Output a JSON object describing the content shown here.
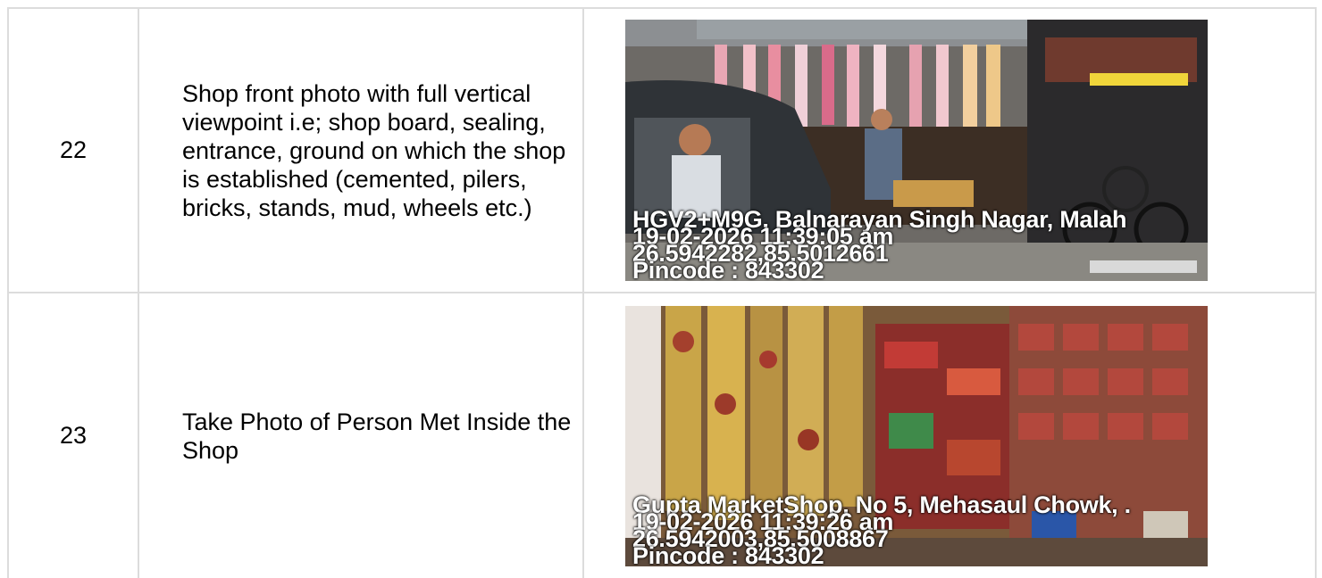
{
  "rows": [
    {
      "number": "22",
      "description": "Shop front photo with full vertical viewpoint i.e; shop board, sealing, entrance, ground on which the shop is established (cemented, pilers, bricks, stands, mud, wheels etc.)",
      "photo_stamp": {
        "address": "HGV2+M9G, Balnarayan Singh Nagar, Malah",
        "datetime": "19-02-2026 11:39:05 am",
        "coordinates": "26.5942282,85.5012661",
        "pincode": "Pincode : 843302"
      }
    },
    {
      "number": "23",
      "description": "Take Photo of Person Met Inside the Shop",
      "photo_stamp": {
        "address": "Gupta MarketShop, No 5, Mehasaul Chowk, .",
        "datetime": "19-02-2026 11:39:26 am",
        "coordinates": "26.5942003,85.5008867",
        "pincode": "Pincode : 843302"
      }
    }
  ]
}
